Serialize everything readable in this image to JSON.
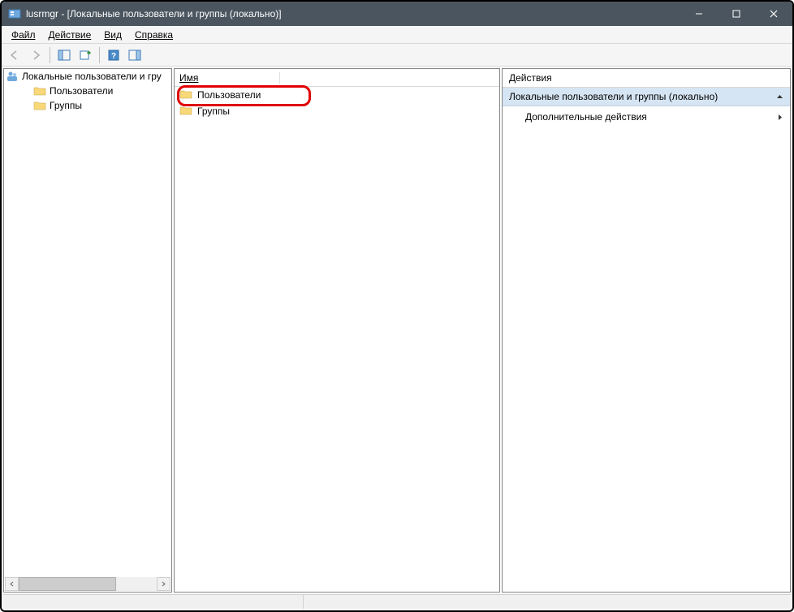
{
  "titlebar": {
    "title": "lusrmgr - [Локальные пользователи и группы (локально)]"
  },
  "menubar": {
    "items": [
      {
        "label": "Файл",
        "u": 0
      },
      {
        "label": "Действие",
        "u": 0
      },
      {
        "label": "Вид",
        "u": 0
      },
      {
        "label": "Справка",
        "u": 0
      }
    ]
  },
  "tree": {
    "root": "Локальные пользователи и гру",
    "children": [
      "Пользователи",
      "Группы"
    ]
  },
  "list": {
    "header": "Имя",
    "items": [
      "Пользователи",
      "Группы"
    ]
  },
  "actions": {
    "title": "Действия",
    "subhead": "Локальные пользователи и группы (локально)",
    "row": "Дополнительные действия"
  }
}
